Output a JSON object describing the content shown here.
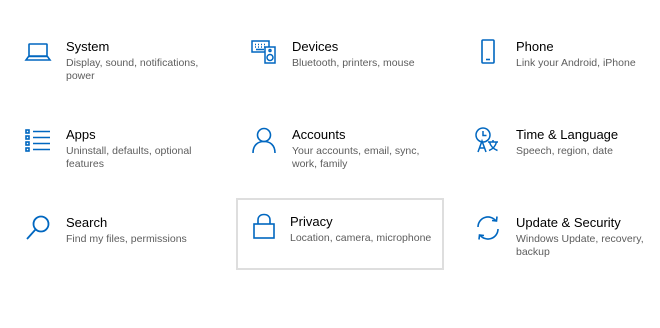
{
  "accent_color": "#0067c0",
  "tiles": [
    {
      "name": "System",
      "desc": "Display, sound, notifications, power",
      "icon": "laptop-icon"
    },
    {
      "name": "Devices",
      "desc": "Bluetooth, printers, mouse",
      "icon": "keyboard-speaker-icon"
    },
    {
      "name": "Phone",
      "desc": "Link your Android, iPhone",
      "icon": "phone-icon"
    },
    {
      "name": "Apps",
      "desc": "Uninstall, defaults, optional features",
      "icon": "apps-list-icon"
    },
    {
      "name": "Accounts",
      "desc": "Your accounts, email, sync, work, family",
      "icon": "person-icon"
    },
    {
      "name": "Time & Language",
      "desc": "Speech, region, date",
      "icon": "time-language-icon"
    },
    {
      "name": "Search",
      "desc": "Find my files, permissions",
      "icon": "search-icon"
    },
    {
      "name": "Privacy",
      "desc": "Location, camera, microphone",
      "icon": "lock-icon"
    },
    {
      "name": "Update & Security",
      "desc": "Windows Update, recovery, backup",
      "icon": "sync-icon"
    }
  ]
}
